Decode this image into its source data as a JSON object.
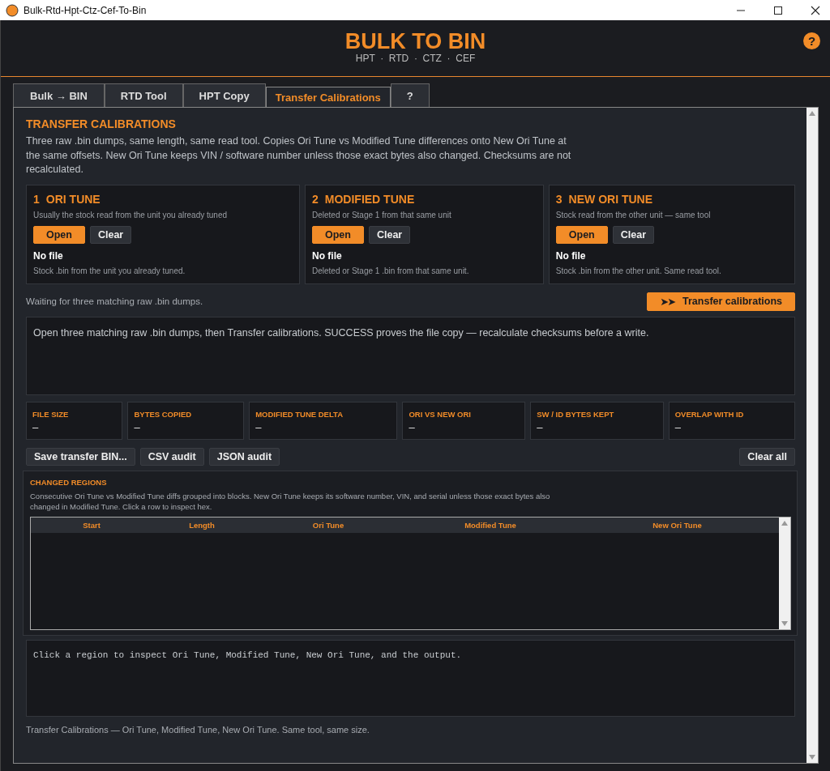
{
  "window": {
    "title": "Bulk-Rtd-Hpt-Ctz-Cef-To-Bin"
  },
  "header": {
    "title": "BULK TO BIN",
    "subtitle": "HPT  ·  RTD  ·  CTZ  ·  CEF",
    "help": "?"
  },
  "tabs": [
    {
      "label": "Bulk → BIN",
      "selected": false
    },
    {
      "label": "RTD Tool",
      "selected": false
    },
    {
      "label": "HPT Copy",
      "selected": false
    },
    {
      "label": "Transfer Calibrations",
      "selected": true
    },
    {
      "label": "?",
      "selected": false
    }
  ],
  "section": {
    "title": "TRANSFER CALIBRATIONS",
    "description": "Three raw .bin dumps, same length, same read tool. Copies Ori Tune vs Modified Tune differences onto New Ori Tune at the same offsets. New Ori Tune keeps VIN / software number unless those exact bytes also changed. Checksums are not recalculated."
  },
  "slots": [
    {
      "number": "1",
      "title": "ORI TUNE",
      "hint": "Usually the stock read from the unit you already tuned",
      "open": "Open",
      "clear": "Clear",
      "file": "No file",
      "detail": "Stock .bin from the unit you already tuned."
    },
    {
      "number": "2",
      "title": "MODIFIED TUNE",
      "hint": "Deleted or Stage 1 from that same unit",
      "open": "Open",
      "clear": "Clear",
      "file": "No file",
      "detail": "Deleted or Stage 1 .bin from that same unit."
    },
    {
      "number": "3",
      "title": "NEW ORI TUNE",
      "hint": "Stock read from the other unit — same tool",
      "open": "Open",
      "clear": "Clear",
      "file": "No file",
      "detail": "Stock .bin from the other unit. Same read tool."
    }
  ],
  "status": "Waiting for three matching raw .bin dumps.",
  "transfer_button": {
    "icon": "➤➤",
    "label": "Transfer calibrations"
  },
  "log": "Open three matching raw .bin dumps, then Transfer calibrations. SUCCESS proves the file copy — recalculate checksums before a write.",
  "metrics": [
    {
      "label": "FILE SIZE",
      "value": "–"
    },
    {
      "label": "BYTES COPIED",
      "value": "–"
    },
    {
      "label": "MODIFIED TUNE DELTA",
      "value": "–"
    },
    {
      "label": "ORI VS NEW ORI",
      "value": "–"
    },
    {
      "label": "SW / ID BYTES KEPT",
      "value": "–"
    },
    {
      "label": "OVERLAP WITH ID",
      "value": "–"
    }
  ],
  "actions": [
    "Save transfer BIN...",
    "CSV audit",
    "JSON audit"
  ],
  "clear_all": "Clear all",
  "regions": {
    "title": "CHANGED REGIONS",
    "description": "Consecutive Ori Tune vs Modified Tune diffs grouped into blocks. New Ori Tune keeps its software number, VIN, and serial unless those exact bytes also changed in Modified Tune. Click a row to inspect hex.",
    "columns": [
      "Start",
      "Length",
      "Ori Tune",
      "Modified Tune",
      "New Ori Tune"
    ]
  },
  "inspector": "Click a region to inspect Ori Tune, Modified Tune, New Ori Tune, and the output.",
  "footer": "Transfer Calibrations — Ori Tune, Modified Tune, New Ori Tune. Same tool, same size."
}
